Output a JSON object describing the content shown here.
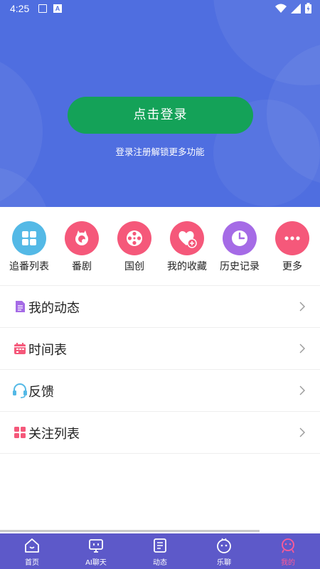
{
  "status_bar": {
    "time": "4:25"
  },
  "header": {
    "login_button": "点击登录",
    "login_subtitle": "登录注册解锁更多功能"
  },
  "quick_menu": [
    {
      "label": "追番列表",
      "icon": "grid-icon",
      "color": "#54b9e6"
    },
    {
      "label": "番剧",
      "icon": "cat-paw-icon",
      "color": "#f5587a"
    },
    {
      "label": "国创",
      "icon": "film-reel-icon",
      "color": "#f5587a"
    },
    {
      "label": "我的收藏",
      "icon": "heart-plus-icon",
      "color": "#f5587a"
    },
    {
      "label": "历史记录",
      "icon": "clock-icon",
      "color": "#a56be6"
    },
    {
      "label": "更多",
      "icon": "more-dots-icon",
      "color": "#f5587a"
    }
  ],
  "menu_list": [
    {
      "label": "我的动态",
      "icon": "document-icon",
      "color": "#a56be6"
    },
    {
      "label": "时间表",
      "icon": "calendar-icon",
      "color": "#f5587a"
    },
    {
      "label": "反馈",
      "icon": "headset-icon",
      "color": "#54b9e6"
    },
    {
      "label": "关注列表",
      "icon": "grid-tiles-icon",
      "color": "#f5587a"
    }
  ],
  "bottom_nav": [
    {
      "label": "首页",
      "icon": "home-icon",
      "active": false
    },
    {
      "label": "AI聊天",
      "icon": "tv-icon",
      "active": false
    },
    {
      "label": "动态",
      "icon": "feed-icon",
      "active": false
    },
    {
      "label": "乐聊",
      "icon": "face-icon",
      "active": false
    },
    {
      "label": "我的",
      "icon": "profile-face-icon",
      "active": true
    }
  ],
  "colors": {
    "header_bg": "#4f6ee0",
    "login_button_bg": "#14a258",
    "nav_bg": "#5d59c9",
    "nav_active": "#ff5b96"
  }
}
